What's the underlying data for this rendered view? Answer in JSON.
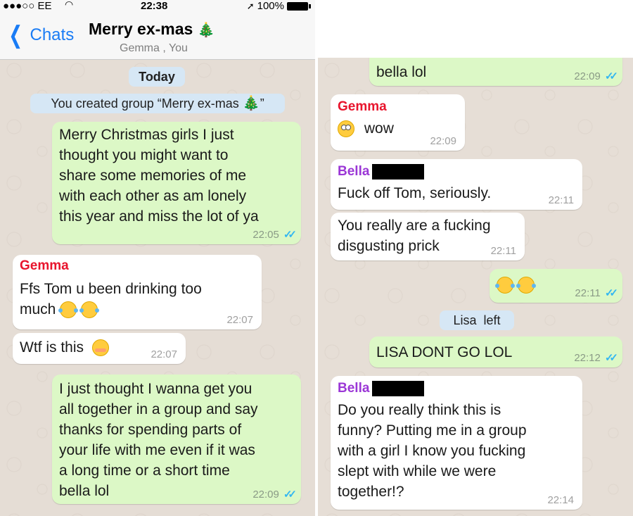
{
  "status_bar": {
    "carrier": "●●●○○ EE",
    "wifi_icon": "wifi-icon",
    "time": "22:38",
    "battery": "100%"
  },
  "header": {
    "back_label": "Chats",
    "title": "Merry ex-mas",
    "title_emoji": "🎄",
    "subtitle": "Gemma , You"
  },
  "left": {
    "date_pill": "Today",
    "system_created": "You created group “Merry ex-mas",
    "system_created_tail": "”",
    "messages": [
      {
        "text": "Merry Christmas girls I just\nthought you might want to\nshare some memories of me\nwith each other as am lonely\nthis year and miss the lot of ya",
        "time": "22:05"
      },
      {
        "sender": "Gemma",
        "text": "Ffs Tom u been drinking too\nmuch",
        "time": "22:07"
      },
      {
        "text": "Wtf is this",
        "time": "22:07"
      },
      {
        "text": "I just thought I wanna get you\nall together in a group and say\nthanks for spending parts of\nyour life with me even if it was\na long time or a short time\nbella lol",
        "time": "22:09"
      }
    ]
  },
  "right": {
    "messages": [
      {
        "text": "bella lol",
        "time": "22:09"
      },
      {
        "sender": "Gemma",
        "text": "wow",
        "time": "22:09"
      },
      {
        "sender": "Bella",
        "text": "Fuck off Tom, seriously.",
        "time": "22:11"
      },
      {
        "text": "You really are a fucking\ndisgusting prick",
        "time": "22:11"
      },
      {
        "text": "",
        "time": "22:11"
      },
      {
        "system": "Lisa  left"
      },
      {
        "text": "LISA DONT GO LOL",
        "time": "22:12"
      },
      {
        "sender": "Bella",
        "text": "Do you really think this is\nfunny? Putting me in a group\nwith a girl I know you fucking\nslept with while we were\ntogether!?",
        "time": "22:14"
      }
    ]
  },
  "colors": {
    "outgoing": "#dcf8c6",
    "incoming": "#ffffff",
    "accent": "#1a7cf5",
    "read_ticks": "#34b7f1",
    "gemma": "#e8142c",
    "bella": "#9b37d6"
  }
}
